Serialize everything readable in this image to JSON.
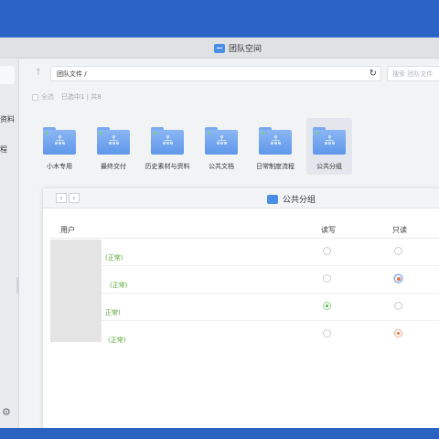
{
  "window": {
    "title": "团队空间",
    "title_icon": "team-space-icon"
  },
  "sidebar": {
    "fragments": [
      "资料",
      "程"
    ],
    "settings_icon": "gear-icon"
  },
  "toolbar": {
    "path": "团队文件 /",
    "search_placeholder": "搜索 团队文件",
    "up_icon": "arrow-up-icon",
    "refresh_icon": "refresh-icon"
  },
  "selection": {
    "select_all": "全选",
    "count": "已选中1 | 共8"
  },
  "folders": [
    {
      "label": "小木专用",
      "selected": false
    },
    {
      "label": "最终交付",
      "selected": false
    },
    {
      "label": "历史素材与资料",
      "selected": false
    },
    {
      "label": "公共文档",
      "selected": false
    },
    {
      "label": "日常制度流程",
      "selected": false
    },
    {
      "label": "公共分组",
      "selected": true
    }
  ],
  "dialog": {
    "title": "公共分组",
    "back_icon": "chevron-left-icon",
    "forward_icon": "chevron-right-icon",
    "columns": {
      "user": "用户",
      "read_write": "读写",
      "read_only": "只读"
    },
    "rows": [
      {
        "status": "(正常)",
        "read_write": false,
        "read_only": false
      },
      {
        "status": "(正常)",
        "read_write": false,
        "read_only": true
      },
      {
        "status": "正常)",
        "read_write": true,
        "read_only": false
      },
      {
        "status": "(正常)",
        "read_write": false,
        "read_only": true
      }
    ],
    "colors": {
      "status_green": "#55a532",
      "radio_green": "#49b04a",
      "radio_orange": "#e8733f"
    }
  }
}
